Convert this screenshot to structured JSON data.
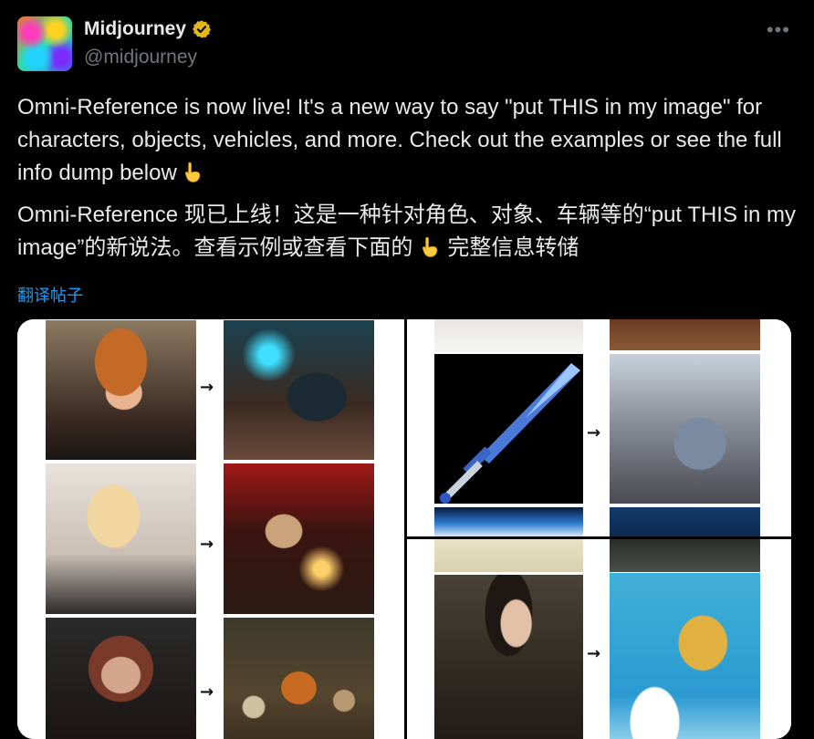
{
  "author": {
    "name": "Midjourney",
    "handle": "@midjourney",
    "verified_color": "#e2b719"
  },
  "menu_icon": "more-horizontal-icon",
  "post": {
    "paragraph_en": "Omni-Reference is now live! It's a new way to say \"put THIS in my image\" for characters, objects, vehicles, and more. Check out the examples or see the full info dump below",
    "paragraph_cn_part1": "Omni-Reference 现已上线！这是一种针对角色、对象、车辆等的“put THIS in my image”的新说法。查看示例或查看下面的",
    "paragraph_cn_part2": "完整信息转储",
    "emoji": "backhand-index-pointing-down"
  },
  "translate_link": "翻译帖子",
  "media": {
    "arrow": "→"
  },
  "colors": {
    "background": "#000000",
    "text": "#e7e9ea",
    "muted": "#71767b",
    "link": "#1d9bf0"
  }
}
